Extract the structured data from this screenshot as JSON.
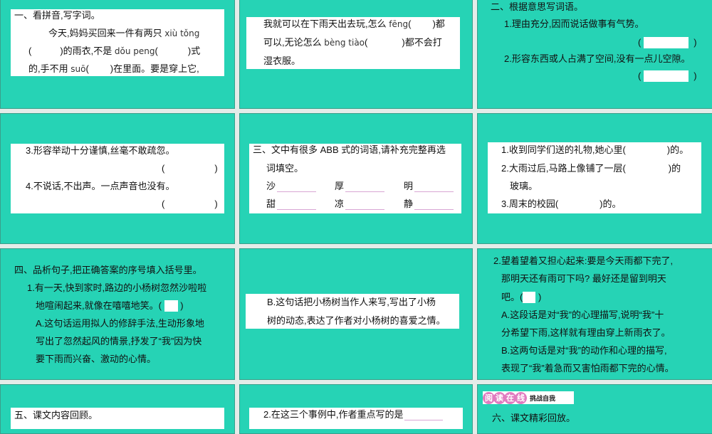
{
  "c1": {
    "title": "一、看拼音,写字词。",
    "l2": "今天,妈妈买回来一件有两只",
    "py1": "xiù tǒng",
    "l3a": "(",
    "l3b": ")的雨衣,不是",
    "py2": "dǒu peng",
    "l3c": "(",
    "l3d": ")式",
    "l4a": "的,手不用",
    "py3": "suō",
    "l4b": "(",
    "l4c": ")在里面。要是穿上它,"
  },
  "c2": {
    "l1a": "我就可以在下雨天出去玩,怎么",
    "py1": "fēng",
    "l1b": "(",
    "l1c": ")都",
    "l2a": "可以,无论怎么",
    "py2": "bèng tiào",
    "l2b": "(",
    "l2c": ")都不会打",
    "l3": "湿衣服。"
  },
  "c3": {
    "title": "二、根据意思写词语。",
    "q1": "1.理由充分,因而说话做事有气势。",
    "q2": "2.形容东西或人占满了空间,没有一点儿空隙。",
    "lp": "(",
    "rp": ")"
  },
  "c4": {
    "q3": "3.形容举动十分谨慎,丝毫不敢疏忽。",
    "q4": "4.不说话,不出声。一点声音也没有。",
    "lp": "(",
    "rp": ")"
  },
  "c5": {
    "title": "三、文中有很多 ABB 式的词语,请补充完整再选",
    "title2": "词填空。",
    "words": [
      "沙",
      "厚",
      "明",
      "甜",
      "凉",
      "静"
    ]
  },
  "c6": {
    "q1a": "1.收到同学们送的礼物,她心里(",
    "q1b": ")的。",
    "q2a": "2.大雨过后,马路上像铺了一层(",
    "q2b": ")的",
    "q2c": "玻璃。",
    "q3a": "3.周末的校园(",
    "q3b": ")的。"
  },
  "c7": {
    "title": "四、品析句子,把正确答案的序号填入括号里。",
    "l1": "1.有一天,快到家时,路边的小杨树忽然沙啦啦",
    "l2a": "地喧闹起来,就像在嘻嘻地笑。(",
    "l2b": ")",
    "l3": "A.这句话运用拟人的修辞手法,生动形象地",
    "l4": "写出了忽然起风的情景,抒发了“我”因为快",
    "l5": "要下雨而兴奋、激动的心情。"
  },
  "c8": {
    "l1": "B.这句话把小杨树当作人来写,写出了小杨",
    "l2": "树的动态,表达了作者对小杨树的喜爱之情。"
  },
  "c9": {
    "l1": "2.望着望着又担心起来:要是今天雨都下完了,",
    "l2": "那明天还有雨可下吗? 最好还是留到明天",
    "l3a": "吧。(",
    "l3b": ")",
    "l4": "A.这段话是对“我”的心理描写,说明“我”十",
    "l5": "分希望下雨,这样就有理由穿上新雨衣了。",
    "l6": "B.这两句话是对“我”的动作和心理的描写,",
    "l7": "表现了“我”着急而又害怕雨都下完的心情。"
  },
  "c10": {
    "title": "五、课文内容回顾。"
  },
  "c11": {
    "l1": "2.在这三个事例中,作者重点写的是"
  },
  "c12": {
    "badge": [
      "阅",
      "读",
      "在",
      "线"
    ],
    "badge_sub": "挑战自我",
    "title": "六、课文精彩回放。"
  }
}
